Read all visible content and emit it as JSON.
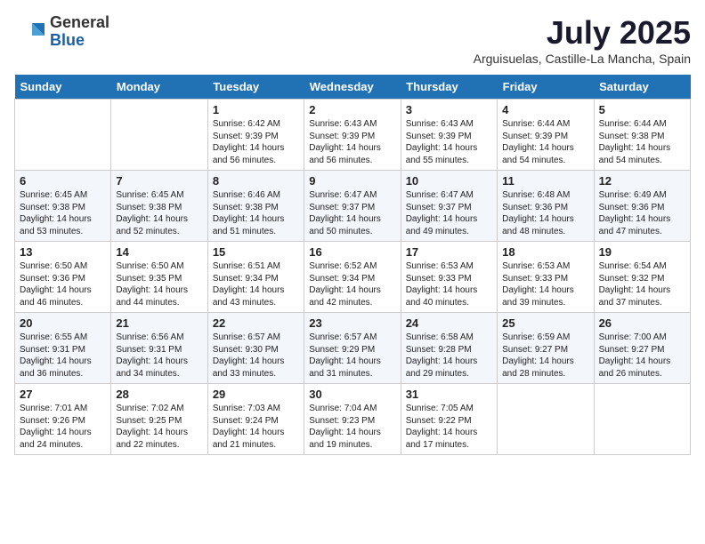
{
  "logo": {
    "general": "General",
    "blue": "Blue"
  },
  "title": "July 2025",
  "location": "Arguisuelas, Castille-La Mancha, Spain",
  "weekdays": [
    "Sunday",
    "Monday",
    "Tuesday",
    "Wednesday",
    "Thursday",
    "Friday",
    "Saturday"
  ],
  "weeks": [
    [
      {
        "day": "",
        "info": ""
      },
      {
        "day": "",
        "info": ""
      },
      {
        "day": "1",
        "info": "Sunrise: 6:42 AM\nSunset: 9:39 PM\nDaylight: 14 hours and 56 minutes."
      },
      {
        "day": "2",
        "info": "Sunrise: 6:43 AM\nSunset: 9:39 PM\nDaylight: 14 hours and 56 minutes."
      },
      {
        "day": "3",
        "info": "Sunrise: 6:43 AM\nSunset: 9:39 PM\nDaylight: 14 hours and 55 minutes."
      },
      {
        "day": "4",
        "info": "Sunrise: 6:44 AM\nSunset: 9:39 PM\nDaylight: 14 hours and 54 minutes."
      },
      {
        "day": "5",
        "info": "Sunrise: 6:44 AM\nSunset: 9:38 PM\nDaylight: 14 hours and 54 minutes."
      }
    ],
    [
      {
        "day": "6",
        "info": "Sunrise: 6:45 AM\nSunset: 9:38 PM\nDaylight: 14 hours and 53 minutes."
      },
      {
        "day": "7",
        "info": "Sunrise: 6:45 AM\nSunset: 9:38 PM\nDaylight: 14 hours and 52 minutes."
      },
      {
        "day": "8",
        "info": "Sunrise: 6:46 AM\nSunset: 9:38 PM\nDaylight: 14 hours and 51 minutes."
      },
      {
        "day": "9",
        "info": "Sunrise: 6:47 AM\nSunset: 9:37 PM\nDaylight: 14 hours and 50 minutes."
      },
      {
        "day": "10",
        "info": "Sunrise: 6:47 AM\nSunset: 9:37 PM\nDaylight: 14 hours and 49 minutes."
      },
      {
        "day": "11",
        "info": "Sunrise: 6:48 AM\nSunset: 9:36 PM\nDaylight: 14 hours and 48 minutes."
      },
      {
        "day": "12",
        "info": "Sunrise: 6:49 AM\nSunset: 9:36 PM\nDaylight: 14 hours and 47 minutes."
      }
    ],
    [
      {
        "day": "13",
        "info": "Sunrise: 6:50 AM\nSunset: 9:36 PM\nDaylight: 14 hours and 46 minutes."
      },
      {
        "day": "14",
        "info": "Sunrise: 6:50 AM\nSunset: 9:35 PM\nDaylight: 14 hours and 44 minutes."
      },
      {
        "day": "15",
        "info": "Sunrise: 6:51 AM\nSunset: 9:34 PM\nDaylight: 14 hours and 43 minutes."
      },
      {
        "day": "16",
        "info": "Sunrise: 6:52 AM\nSunset: 9:34 PM\nDaylight: 14 hours and 42 minutes."
      },
      {
        "day": "17",
        "info": "Sunrise: 6:53 AM\nSunset: 9:33 PM\nDaylight: 14 hours and 40 minutes."
      },
      {
        "day": "18",
        "info": "Sunrise: 6:53 AM\nSunset: 9:33 PM\nDaylight: 14 hours and 39 minutes."
      },
      {
        "day": "19",
        "info": "Sunrise: 6:54 AM\nSunset: 9:32 PM\nDaylight: 14 hours and 37 minutes."
      }
    ],
    [
      {
        "day": "20",
        "info": "Sunrise: 6:55 AM\nSunset: 9:31 PM\nDaylight: 14 hours and 36 minutes."
      },
      {
        "day": "21",
        "info": "Sunrise: 6:56 AM\nSunset: 9:31 PM\nDaylight: 14 hours and 34 minutes."
      },
      {
        "day": "22",
        "info": "Sunrise: 6:57 AM\nSunset: 9:30 PM\nDaylight: 14 hours and 33 minutes."
      },
      {
        "day": "23",
        "info": "Sunrise: 6:57 AM\nSunset: 9:29 PM\nDaylight: 14 hours and 31 minutes."
      },
      {
        "day": "24",
        "info": "Sunrise: 6:58 AM\nSunset: 9:28 PM\nDaylight: 14 hours and 29 minutes."
      },
      {
        "day": "25",
        "info": "Sunrise: 6:59 AM\nSunset: 9:27 PM\nDaylight: 14 hours and 28 minutes."
      },
      {
        "day": "26",
        "info": "Sunrise: 7:00 AM\nSunset: 9:27 PM\nDaylight: 14 hours and 26 minutes."
      }
    ],
    [
      {
        "day": "27",
        "info": "Sunrise: 7:01 AM\nSunset: 9:26 PM\nDaylight: 14 hours and 24 minutes."
      },
      {
        "day": "28",
        "info": "Sunrise: 7:02 AM\nSunset: 9:25 PM\nDaylight: 14 hours and 22 minutes."
      },
      {
        "day": "29",
        "info": "Sunrise: 7:03 AM\nSunset: 9:24 PM\nDaylight: 14 hours and 21 minutes."
      },
      {
        "day": "30",
        "info": "Sunrise: 7:04 AM\nSunset: 9:23 PM\nDaylight: 14 hours and 19 minutes."
      },
      {
        "day": "31",
        "info": "Sunrise: 7:05 AM\nSunset: 9:22 PM\nDaylight: 14 hours and 17 minutes."
      },
      {
        "day": "",
        "info": ""
      },
      {
        "day": "",
        "info": ""
      }
    ]
  ]
}
